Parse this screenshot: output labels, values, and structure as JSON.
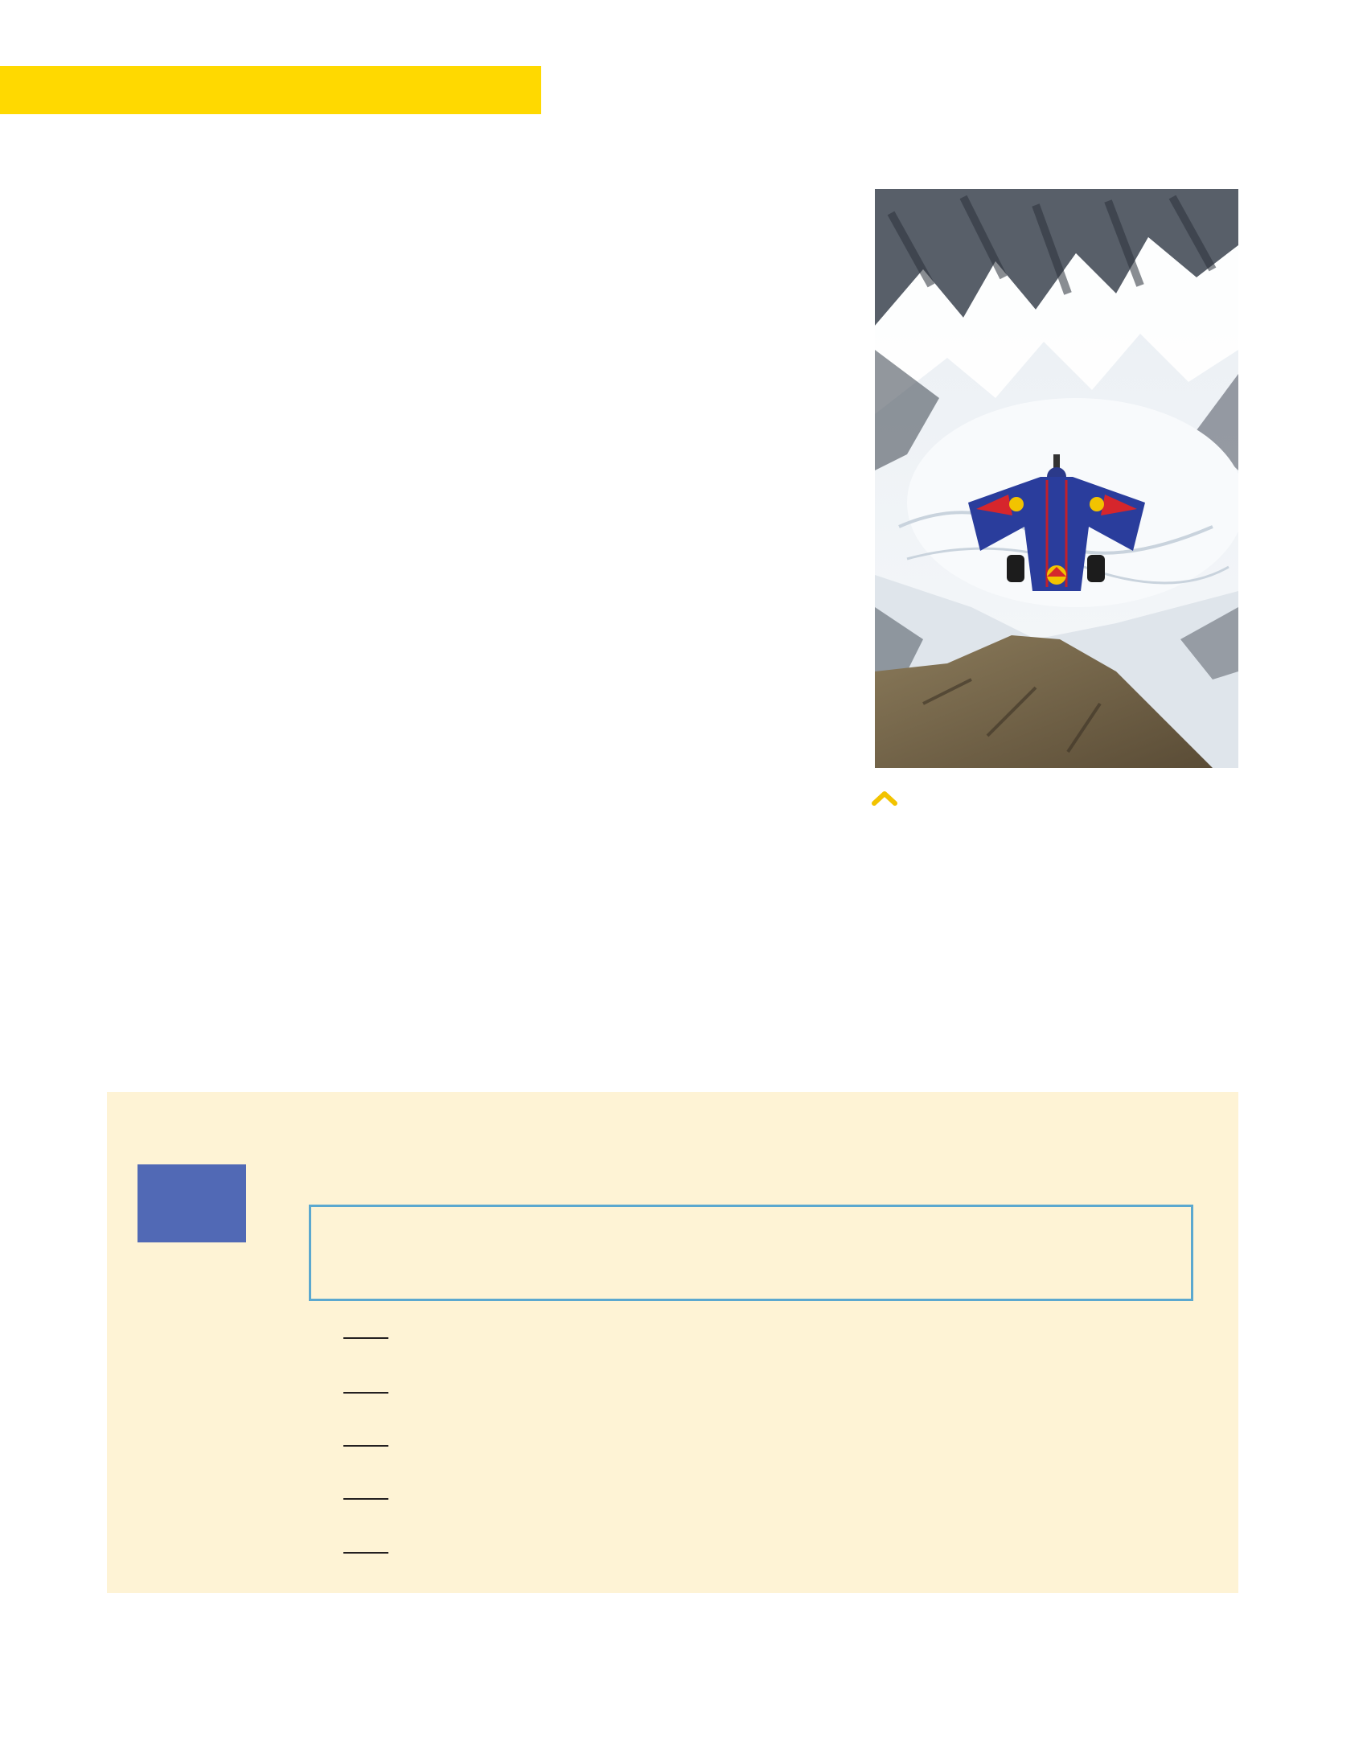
{
  "colors": {
    "header_bar": "#FFD900",
    "panel_background": "#FEF3D5",
    "number_square": "#5169B5",
    "word_box_border": "#5BA8CF",
    "caret": "#F2C300"
  },
  "photo": {
    "icon": "wingsuit-flyer-over-snowy-mountain-photo"
  },
  "caption_marker": {
    "icon": "chevron-up-icon"
  },
  "exercise": {
    "blank_count": 5
  }
}
